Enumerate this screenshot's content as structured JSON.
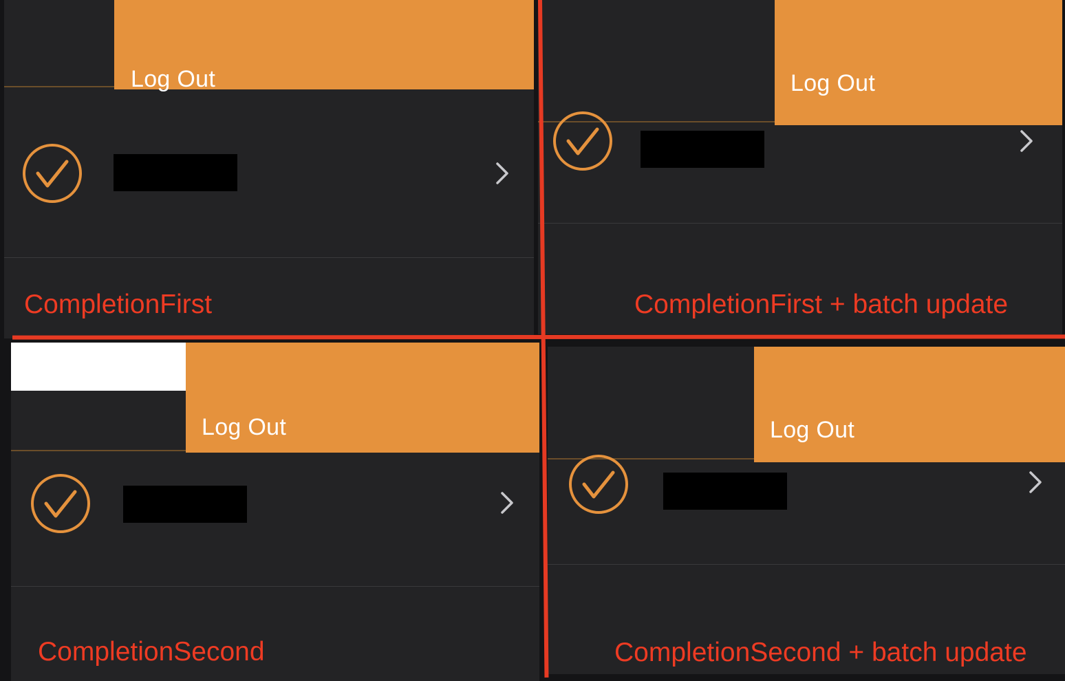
{
  "colors": {
    "accent": "#e5923d",
    "cell_background": "#232325",
    "caption_red": "#ee3b23",
    "divider_red": "#e63a23"
  },
  "panels": [
    {
      "swipe_action_label": "Log Out",
      "caption": "CompletionFirst",
      "row_icon": "checkmark-circle-icon",
      "disclosure_icon": "chevron-right-icon"
    },
    {
      "swipe_action_label": "Log Out",
      "caption": "CompletionFirst + batch update",
      "row_icon": "checkmark-circle-icon",
      "disclosure_icon": "chevron-right-icon"
    },
    {
      "swipe_action_label": "Log Out",
      "caption": "CompletionSecond",
      "row_icon": "checkmark-circle-icon",
      "disclosure_icon": "chevron-right-icon"
    },
    {
      "swipe_action_label": "Log Out",
      "caption": "CompletionSecond + batch update",
      "row_icon": "checkmark-circle-icon",
      "disclosure_icon": "chevron-right-icon"
    }
  ]
}
